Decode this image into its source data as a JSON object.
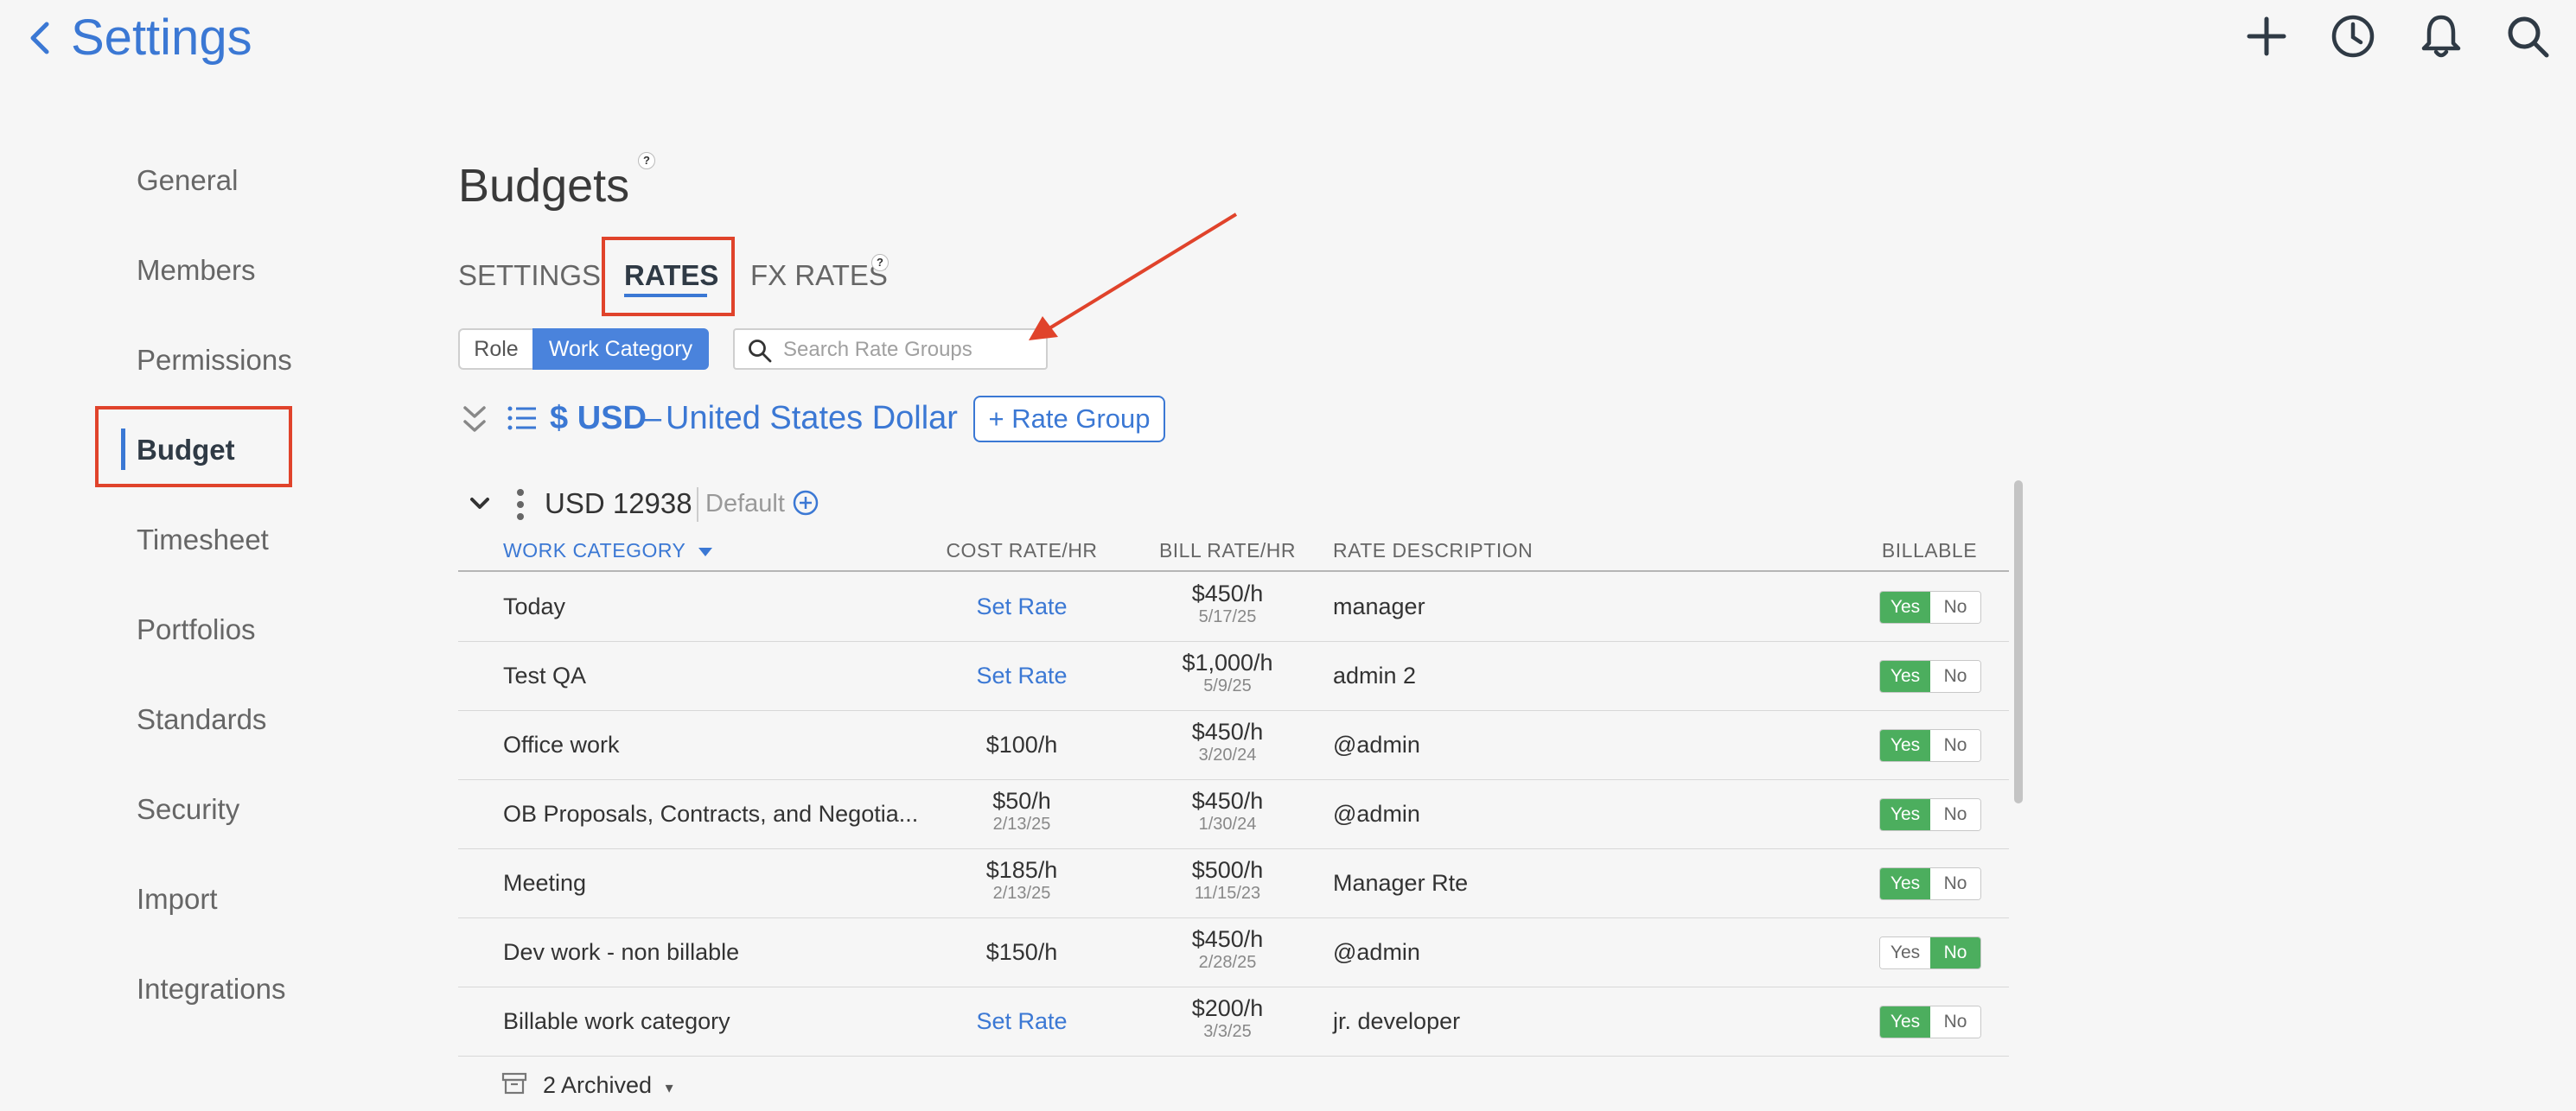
{
  "header": {
    "title": "Settings",
    "icons": [
      "back-chevron-icon",
      "plus-icon",
      "clock-icon",
      "bell-icon",
      "search-icon"
    ]
  },
  "sidebar": {
    "items": [
      {
        "label": "General"
      },
      {
        "label": "Members"
      },
      {
        "label": "Permissions"
      },
      {
        "label": "Budget",
        "active": true
      },
      {
        "label": "Timesheet"
      },
      {
        "label": "Portfolios"
      },
      {
        "label": "Standards"
      },
      {
        "label": "Security"
      },
      {
        "label": "Import"
      },
      {
        "label": "Integrations"
      }
    ]
  },
  "page": {
    "title": "Budgets",
    "help": "?"
  },
  "tabs": [
    {
      "label": "SETTINGS"
    },
    {
      "label": "RATES",
      "active": true
    },
    {
      "label": "FX RATES",
      "help": "?"
    }
  ],
  "toggle": {
    "options": [
      "Role",
      "Work Category"
    ],
    "selected": "Work Category"
  },
  "search": {
    "placeholder": "Search Rate Groups",
    "value": ""
  },
  "currency": {
    "code": "$ USD",
    "dash": "–",
    "name": "United States Dollar",
    "add_button": "+ Rate Group"
  },
  "rate_group": {
    "name": "USD 12938",
    "default_label": "Default"
  },
  "table": {
    "headers": {
      "work_category": "WORK CATEGORY",
      "cost_rate": "COST RATE/HR",
      "bill_rate": "BILL RATE/HR",
      "rate_description": "RATE DESCRIPTION",
      "billable": "BILLABLE"
    },
    "rows": [
      {
        "name": "Today",
        "cost": "Set Rate",
        "cost_date": "",
        "bill": "$450/h",
        "bill_date": "5/17/25",
        "desc": "manager",
        "billable": "Yes"
      },
      {
        "name": "Test QA",
        "cost": "Set Rate",
        "cost_date": "",
        "bill": "$1,000/h",
        "bill_date": "5/9/25",
        "desc": "admin 2",
        "billable": "Yes"
      },
      {
        "name": "Office work",
        "cost": "$100/h",
        "cost_date": "",
        "bill": "$450/h",
        "bill_date": "3/20/24",
        "desc": "@admin",
        "billable": "Yes"
      },
      {
        "name": "OB Proposals, Contracts, and Negotia...",
        "cost": "$50/h",
        "cost_date": "2/13/25",
        "bill": "$450/h",
        "bill_date": "1/30/24",
        "desc": "@admin",
        "billable": "Yes"
      },
      {
        "name": "Meeting",
        "cost": "$185/h",
        "cost_date": "2/13/25",
        "bill": "$500/h",
        "bill_date": "11/15/23",
        "desc": "Manager Rte",
        "billable": "Yes"
      },
      {
        "name": "Dev work - non billable",
        "cost": "$150/h",
        "cost_date": "",
        "bill": "$450/h",
        "bill_date": "2/28/25",
        "desc": "@admin",
        "billable": "No"
      },
      {
        "name": "Billable work category",
        "cost": "Set Rate",
        "cost_date": "",
        "bill": "$200/h",
        "bill_date": "3/3/25",
        "desc": "jr. developer",
        "billable": "Yes"
      }
    ],
    "yes_label": "Yes",
    "no_label": "No"
  },
  "archived": {
    "label": "2 Archived",
    "caret": "▾"
  },
  "colors": {
    "accent": "#3b78d4",
    "annotation_red": "#e0432b",
    "billable_green": "#4cae5e"
  }
}
